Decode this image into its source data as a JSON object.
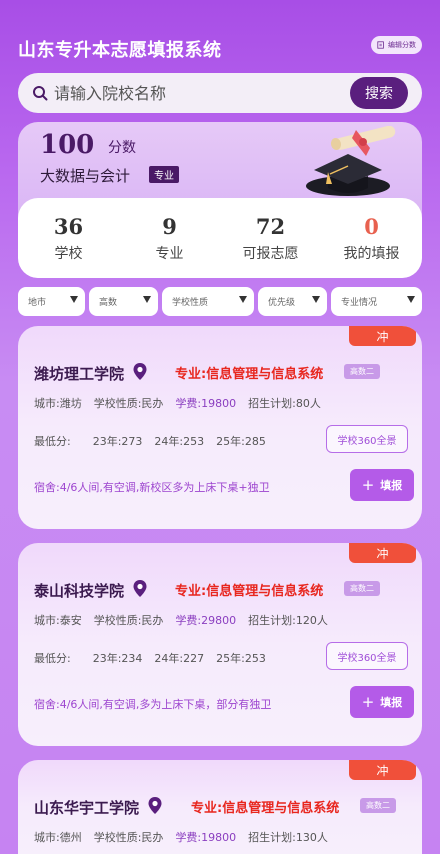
{
  "header": {
    "title": "山东专升本志愿填报系统",
    "edit_label": "编辑分数",
    "edit_icon": "edit-icon"
  },
  "search": {
    "placeholder": "请输入院校名称",
    "button_label": "搜索",
    "icon": "search-icon"
  },
  "profile": {
    "score": "100",
    "score_unit": "分数",
    "major": "大数据与会计",
    "major_tag": "专业"
  },
  "stats": [
    {
      "value": "36",
      "label": "学校"
    },
    {
      "value": "9",
      "label": "专业"
    },
    {
      "value": "72",
      "label": "可报志愿"
    },
    {
      "value": "0",
      "label": "我的填报"
    }
  ],
  "filters": [
    "地市",
    "高数",
    "学校性质",
    "优先级",
    "专业情况"
  ],
  "schools": [
    {
      "tag": "冲",
      "name": "潍坊理工学院",
      "major": "专业:信息管理与信息系统",
      "level": "高数二",
      "city": "城市:潍坊",
      "nature": "学校性质:民办",
      "fee": "学费:19800",
      "plan": "招生计划:80人",
      "min_label": "最低分:",
      "s23": "23年:273",
      "s24": "24年:253",
      "s25": "25年:285",
      "view_label": "学校360全景",
      "dorm": "宿舍:4/6人间,有空调,新校区多为上床下桌+独卫",
      "apply_label": "填报"
    },
    {
      "tag": "冲",
      "name": "泰山科技学院",
      "major": "专业:信息管理与信息系统",
      "level": "高数二",
      "city": "城市:泰安",
      "nature": "学校性质:民办",
      "fee": "学费:29800",
      "plan": "招生计划:120人",
      "min_label": "最低分:",
      "s23": "23年:234",
      "s24": "24年:227",
      "s25": "25年:253",
      "view_label": "学校360全景",
      "dorm": "宿舍:4/6人间,有空调,多为上床下桌，部分有独卫",
      "apply_label": "填报"
    },
    {
      "tag": "冲",
      "name": "山东华宇工学院",
      "major": "专业:信息管理与信息系统",
      "level": "高数二",
      "city": "城市:德州",
      "nature": "学校性质:民办",
      "fee": "学费:19800",
      "plan": "招生计划:130人"
    }
  ],
  "colors": {
    "accent": "#5a1f7e",
    "rush": "#f0503a",
    "major_red": "#e8261e",
    "apply": "#b45be8"
  }
}
